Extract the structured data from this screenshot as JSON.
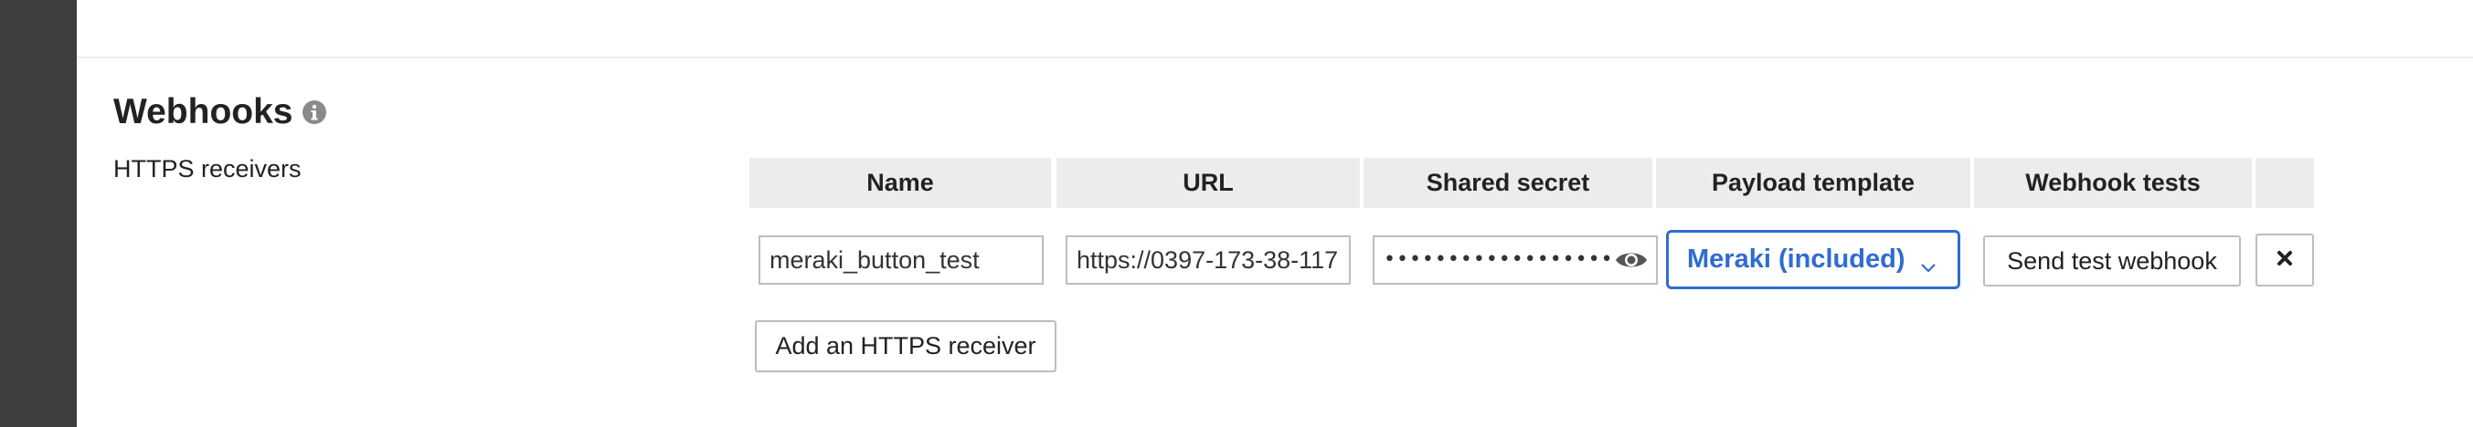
{
  "section": {
    "title": "Webhooks",
    "row_label": "HTTPS receivers"
  },
  "table": {
    "headers": [
      "Name",
      "URL",
      "Shared secret",
      "Payload template",
      "Webhook tests",
      ""
    ],
    "row": {
      "name_value": "meraki_button_test",
      "url_value": "https://0397-173-38-117",
      "secret_mask": "••••••••••••••••••••",
      "payload_template": "Meraki (included)",
      "test_button_label": "Send test webhook"
    }
  },
  "add_receiver_label": "Add an HTTPS receiver",
  "icons": {
    "info": "info-icon",
    "eye": "eye-icon",
    "chevron": "chevron-down-icon",
    "remove": "close-icon"
  },
  "colors": {
    "left_rail": "#3d3e40",
    "header_bg": "#ececec",
    "accent": "#2f6cd1",
    "border": "#bdbdbd"
  }
}
